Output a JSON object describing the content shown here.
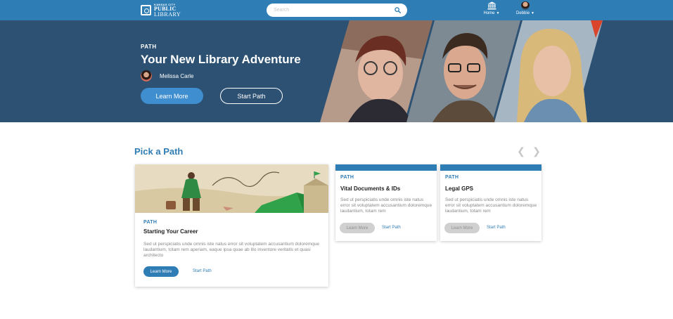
{
  "header": {
    "logo": {
      "line1": "KANSAS CITY",
      "line2": "PUBLIC",
      "line3": "LIBRARY"
    },
    "search": {
      "placeholder": "Search",
      "value": ""
    },
    "nav": {
      "home_label": "Home",
      "user_label": "Debbie"
    },
    "colors": {
      "bar": "#2f7db5"
    }
  },
  "hero": {
    "label": "PATH",
    "title": "Your New Library Adventure",
    "author": "Melissa Carle",
    "primary_button": "Learn More",
    "secondary_button": "Start Path",
    "background": "#2d5173"
  },
  "section": {
    "title": "Pick a Path",
    "prev_icon": "chevron-left-icon",
    "next_icon": "chevron-right-icon"
  },
  "cards": [
    {
      "label": "PATH",
      "title": "Starting Your Career",
      "description": "Sed ut perspiciatis unde omnis iste natus error sit voluptatem accusantium doloremque laudantium, totam rem aperiam, eaque ipsa quae ab illo inventore veritatis et quasi architecto",
      "learn_more": "Learn More",
      "start_path": "Start Path"
    },
    {
      "label": "PATH",
      "title": "Vital Documents & IDs",
      "description": "Sed ut perspiciatis unde omnis iste natus error sit voluptatem accusantium doloremque laudantium, totam rem",
      "learn_more": "Learn More",
      "start_path": "Start Path"
    },
    {
      "label": "PATH",
      "title": "Legal GPS",
      "description": "Sed ut perspiciatis unde omnis iste natus error sit voluptatem accusantium doloremque laudantium, totam rem",
      "learn_more": "Learn More",
      "start_path": "Start Path"
    }
  ]
}
